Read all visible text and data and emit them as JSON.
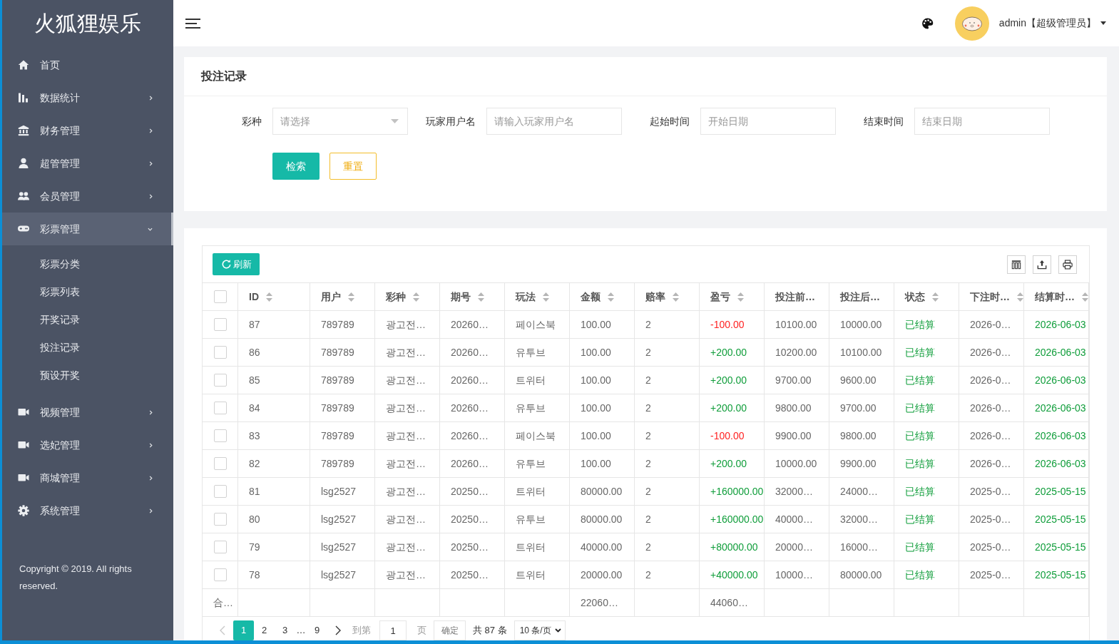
{
  "sidebar": {
    "logo": "火狐狸娱乐",
    "items": [
      {
        "label": "首页",
        "kind": "link",
        "expanded": false
      },
      {
        "label": "数据统计",
        "kind": "group",
        "expanded": false
      },
      {
        "label": "财务管理",
        "kind": "group",
        "expanded": false
      },
      {
        "label": "超管管理",
        "kind": "group",
        "expanded": false
      },
      {
        "label": "会员管理",
        "kind": "group",
        "expanded": false
      },
      {
        "label": "彩票管理",
        "kind": "group",
        "expanded": true,
        "children": [
          {
            "label": "彩票分类"
          },
          {
            "label": "彩票列表"
          },
          {
            "label": "开奖记录"
          },
          {
            "label": "投注记录"
          },
          {
            "label": "预设开奖"
          }
        ]
      },
      {
        "label": "视频管理",
        "kind": "group",
        "expanded": false
      },
      {
        "label": "选妃管理",
        "kind": "group",
        "expanded": false
      },
      {
        "label": "商城管理",
        "kind": "group",
        "expanded": false
      },
      {
        "label": "系统管理",
        "kind": "group",
        "expanded": false
      }
    ],
    "copyright": "Copyright © 2019. All rights reserved."
  },
  "header": {
    "user_label": "admin【超级管理员】"
  },
  "search_card": {
    "title": "投注记录",
    "fields": [
      {
        "label": "彩种",
        "kind": "select",
        "placeholder": "请选择"
      },
      {
        "label": "玩家用户名",
        "kind": "text",
        "placeholder": "请输入玩家用户名"
      },
      {
        "label": "起始时间",
        "kind": "date",
        "placeholder": "开始日期"
      },
      {
        "label": "结束时间",
        "kind": "date",
        "placeholder": "结束日期"
      }
    ],
    "buttons": [
      {
        "label": "检索",
        "kind": "primary"
      },
      {
        "label": "重置",
        "kind": "outline"
      }
    ]
  },
  "table": {
    "refresh_label": "刷新",
    "all_checked": false,
    "columns": [
      {
        "label": "ID",
        "sortable": true
      },
      {
        "label": "用户",
        "sortable": true
      },
      {
        "label": "彩种",
        "sortable": true
      },
      {
        "label": "期号",
        "sortable": true
      },
      {
        "label": "玩法",
        "sortable": true
      },
      {
        "label": "金额",
        "sortable": true,
        "total": "22060…"
      },
      {
        "label": "赔率",
        "sortable": true
      },
      {
        "label": "盈亏",
        "sortable": true,
        "total": "44060…"
      },
      {
        "label": "投注前…",
        "sortable": false
      },
      {
        "label": "投注后…",
        "sortable": false
      },
      {
        "label": "状态",
        "sortable": true
      },
      {
        "label": "下注时…",
        "sortable": true
      },
      {
        "label": "结算时…",
        "sortable": true
      }
    ],
    "rows": [
      {
        "checked": false,
        "loss": true,
        "settled": true,
        "cells": [
          "87",
          "789789",
          "광고전…",
          "20260…",
          "페이스북",
          "100.00",
          "2",
          "-100.00",
          "10100.00",
          "10000.00",
          "已结算",
          "2026-0…",
          "2026-06-03"
        ]
      },
      {
        "checked": false,
        "loss": false,
        "settled": true,
        "cells": [
          "86",
          "789789",
          "광고전…",
          "20260…",
          "유투브",
          "100.00",
          "2",
          "+200.00",
          "10200.00",
          "10100.00",
          "已结算",
          "2026-0…",
          "2026-06-03"
        ]
      },
      {
        "checked": false,
        "loss": false,
        "settled": true,
        "cells": [
          "85",
          "789789",
          "광고전…",
          "20260…",
          "트위터",
          "100.00",
          "2",
          "+200.00",
          "9700.00",
          "9600.00",
          "已结算",
          "2026-0…",
          "2026-06-03"
        ]
      },
      {
        "checked": false,
        "loss": false,
        "settled": true,
        "cells": [
          "84",
          "789789",
          "광고전…",
          "20260…",
          "유투브",
          "100.00",
          "2",
          "+200.00",
          "9800.00",
          "9700.00",
          "已结算",
          "2026-0…",
          "2026-06-03"
        ]
      },
      {
        "checked": false,
        "loss": true,
        "settled": true,
        "cells": [
          "83",
          "789789",
          "광고전…",
          "20260…",
          "페이스북",
          "100.00",
          "2",
          "-100.00",
          "9900.00",
          "9800.00",
          "已结算",
          "2026-0…",
          "2026-06-03"
        ]
      },
      {
        "checked": false,
        "loss": false,
        "settled": true,
        "cells": [
          "82",
          "789789",
          "광고전…",
          "20260…",
          "유투브",
          "100.00",
          "2",
          "+200.00",
          "10000.00",
          "9900.00",
          "已结算",
          "2026-0…",
          "2026-06-03"
        ]
      },
      {
        "checked": false,
        "loss": false,
        "settled": true,
        "cells": [
          "81",
          "lsg2527",
          "광고전…",
          "20250…",
          "트위터",
          "80000.00",
          "2",
          "+160000.00",
          "32000…",
          "24000…",
          "已结算",
          "2025-0…",
          "2025-05-15"
        ]
      },
      {
        "checked": false,
        "loss": false,
        "settled": true,
        "cells": [
          "80",
          "lsg2527",
          "광고전…",
          "20250…",
          "유투브",
          "80000.00",
          "2",
          "+160000.00",
          "40000…",
          "32000…",
          "已结算",
          "2025-0…",
          "2025-05-15"
        ]
      },
      {
        "checked": false,
        "loss": false,
        "settled": true,
        "cells": [
          "79",
          "lsg2527",
          "광고전…",
          "20250…",
          "트위터",
          "40000.00",
          "2",
          "+80000.00",
          "20000…",
          "16000…",
          "已结算",
          "2025-0…",
          "2025-05-15"
        ]
      },
      {
        "checked": false,
        "loss": false,
        "settled": true,
        "cells": [
          "78",
          "lsg2527",
          "광고전…",
          "20250…",
          "트위터",
          "20000.00",
          "2",
          "+40000.00",
          "10000…",
          "80000.00",
          "已结算",
          "2025-0…",
          "2025-05-15"
        ]
      }
    ],
    "summary_label": "合…"
  },
  "pagination": {
    "prev_disabled": true,
    "next_disabled": false,
    "pages": [
      {
        "kind": "page",
        "label": "1",
        "selected": true
      },
      {
        "kind": "page",
        "label": "2",
        "selected": false
      },
      {
        "kind": "page",
        "label": "3",
        "selected": false
      },
      {
        "kind": "ellipsis",
        "label": "…"
      },
      {
        "kind": "page",
        "label": "9",
        "selected": false
      }
    ],
    "goto_label": "到第",
    "goto_value": "1",
    "page_unit": "页",
    "confirm": "确定",
    "total": "共 87 条",
    "page_size": "10 条/页"
  }
}
